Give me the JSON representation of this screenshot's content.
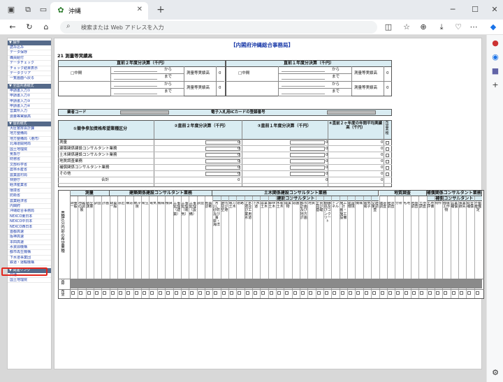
{
  "browser": {
    "tab_title": "沖縄",
    "address_placeholder": "検索または Web アドレスを入力",
    "new_tab": "+"
  },
  "icons": {
    "tab_icon": "okinawa-favicon-icon"
  },
  "sidebar": {
    "sections": [
      {
        "header": "▼ 操作",
        "items": [
          "読み込み",
          "データ保存",
          "職員給付",
          "データチェック",
          "チェック結果表示",
          "データクリア",
          "一覧画面へ戻る"
        ]
      },
      {
        "header": "▼ 全国共通様式",
        "items": [
          "申請書入力①",
          "申請書入力②",
          "申請書入力③",
          "申請書入力④",
          "営業所入力",
          "測量等実績高"
        ]
      },
      {
        "header": "▼ 個別様式",
        "items": [
          "大臣官房会計課",
          "地方整備局",
          "地方整備局（港湾）",
          "北海道開発局",
          "国土地理院",
          "気象庁",
          "財務省",
          "文部科学省",
          "農林水産省",
          "農業農村局",
          "林野庁",
          "経済産業省",
          "環境省",
          "防衛省",
          "農業経済省",
          "内閣府",
          "沖縄総合事務局",
          "NEXCO東日本",
          "NEXCO中日本",
          "NEXCO西日本",
          "首都高速",
          "阪神高速",
          "本四高速",
          "水資源機構",
          "都市再生機構",
          "下水道事業団",
          "鉄道・運輸機構"
        ]
      },
      {
        "header": "▼ 関連リンク",
        "items": [
          "共通",
          "国土地理院"
        ]
      }
    ]
  },
  "main": {
    "bureau_title": "【内閣府沖縄総合事務局】",
    "section_title": "21 測量等実績高",
    "prev2_header": "直前２年度分決算（千円）",
    "prev1_header": "直前１年度分決算（千円）",
    "middle_label": "□中間",
    "kara": "から",
    "made": "まで",
    "survey_label": "測量等実績高",
    "zero": "0",
    "gyosha_code": "業者コード",
    "ic_card": "電子入札用ICカードの登録番号",
    "col1": "①競争参加資格希望業種区分",
    "col2": "②直前２年度分決算（千円）",
    "col3": "③直前１年度分決算（千円）",
    "col4": "④直前２ヶ年度の年間平均実績高（千円）",
    "col5": "希望業種",
    "rows": [
      "測量",
      "建築関係建設コンサルタント業務",
      "土木関係建設コンサルタント業務",
      "地質調査業務",
      "補償関係コンサルタント業務",
      "その他",
      "合計"
    ],
    "cat_headers": [
      "測量",
      "建築関係建設コンサルタント業務",
      "土木関係建設コンサルタント業務",
      "建設コンサルタント",
      "補償関係コンサルタント業務",
      "補償コンサルタント",
      "地質調査"
    ],
    "left_label": "業種区分内部の希望業種",
    "row_label_reg": "登録",
    "row_label_wish": "希望",
    "subcats": [
      "測量一般",
      "地図の調製",
      "航空測量",
      "調査",
      "計画",
      "建築一般",
      "意匠",
      "構造",
      "暖冷房",
      "衛生",
      "電気",
      "機械",
      "積算",
      "工事監理（建築）",
      "工事監理（電気）",
      "工事監理（設備）",
      "調査",
      "耐震診断",
      "河川、砂防及び海岸・海洋",
      "港湾及び空港",
      "電力土木",
      "道路",
      "上水道及び工業用水道",
      "下水道",
      "農業土木",
      "森林土木",
      "水産土木",
      "廃棄物",
      "造園",
      "都市計画及び地方計画",
      "地質",
      "土質及び基礎",
      "鋼構造及びコンクリート",
      "トンネル",
      "施工計画・施工設備",
      "建設環境",
      "機械",
      "電気電子",
      "交通量調査",
      "環境調査",
      "経済調査",
      "分析",
      "宅地",
      "地盤調査",
      "土地調査",
      "土地評価",
      "物件",
      "機械工作物",
      "営業補償",
      "事業損失",
      "総合補償",
      "不動産鑑定"
    ]
  }
}
